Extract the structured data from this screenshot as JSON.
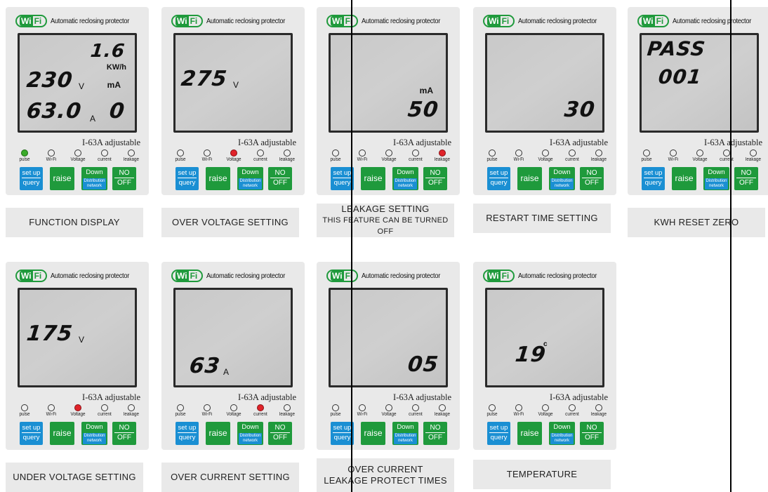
{
  "header": {
    "wifi_wi": "Wi",
    "wifi_fi": "Fi",
    "title": "Automatic reclosing protector"
  },
  "common": {
    "adjustable": "I-63A adjustable",
    "indicators": [
      "pulse",
      "Wi-Fi",
      "Voltage",
      "current",
      "leakage"
    ],
    "buttons": {
      "setup": "set up",
      "query": "query",
      "raise": "raise",
      "down": "Down",
      "distribution": "Distribution network",
      "no": "NO",
      "off": "OFF"
    }
  },
  "colors": {
    "green": "#1f9a3c",
    "blue": "#1a8fd3",
    "led_green": "#3aab2a",
    "led_red": "#e0232a"
  },
  "panels": [
    {
      "id": "function-display",
      "lit": "pulse",
      "lit_color": "green",
      "lcd": {
        "top_right": "1.6",
        "top_right_unit": "KW/h",
        "mid_left": "230",
        "mid_left_unit": "V",
        "mid_right_unit": "mA",
        "bottom_left": "63.0",
        "bottom_left_unit": "A",
        "bottom_right": "0"
      },
      "caption": [
        "FUNCTION DISPLAY"
      ]
    },
    {
      "id": "over-voltage",
      "lit": "Voltage",
      "lit_color": "red",
      "lcd": {
        "value": "275",
        "unit": "V"
      },
      "caption": [
        "OVER VOLTAGE SETTING"
      ]
    },
    {
      "id": "leakage",
      "lit": "leakage",
      "lit_color": "red",
      "lcd": {
        "unit": "mA",
        "value": "50"
      },
      "caption": [
        "LEAKAGE SETTING",
        "THIS FEATURE CAN BE TURNED OFF"
      ]
    },
    {
      "id": "restart-time",
      "lit": "",
      "lit_color": "",
      "lcd": {
        "value": "30"
      },
      "caption": [
        "RESTART TIME SETTING"
      ]
    },
    {
      "id": "kwh-reset",
      "lit": "",
      "lit_color": "",
      "lcd": {
        "line1": "PASS",
        "line2": "001"
      },
      "caption": [
        "KWH RESET ZERO"
      ]
    },
    {
      "id": "under-voltage",
      "lit": "Voltage",
      "lit_color": "red",
      "lcd": {
        "value": "175",
        "unit": "V"
      },
      "caption": [
        "UNDER VOLTAGE SETTING"
      ]
    },
    {
      "id": "over-current",
      "lit": "current",
      "lit_color": "red",
      "lcd": {
        "value": "63",
        "unit": "A"
      },
      "caption": [
        "OVER CURRENT SETTING"
      ]
    },
    {
      "id": "protect-times",
      "lit": "",
      "lit_color": "",
      "lcd": {
        "value": "05"
      },
      "caption": [
        "OVER CURRENT",
        "LEAKAGE PROTECT TIMES"
      ]
    },
    {
      "id": "temperature",
      "lit": "",
      "lit_color": "",
      "lcd": {
        "value": "19",
        "unit": "c"
      },
      "caption": [
        "TEMPERATURE"
      ]
    }
  ]
}
